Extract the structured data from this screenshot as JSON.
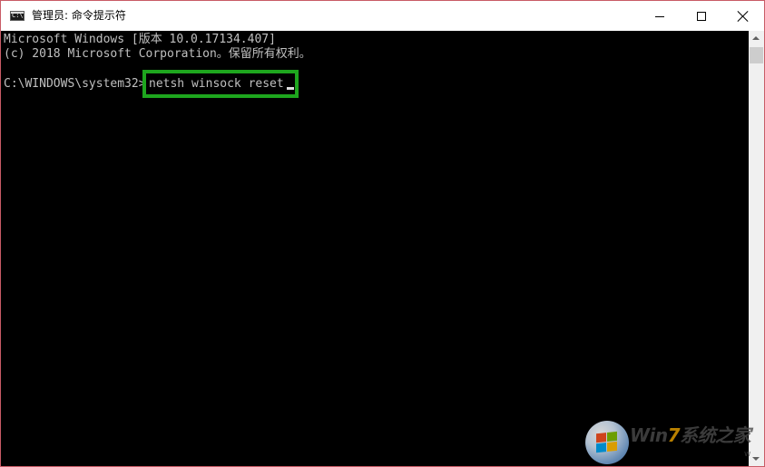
{
  "window": {
    "title": "管理员: 命令提示符",
    "icon": "cmd-icon"
  },
  "titlebar_buttons": {
    "minimize_icon": "minimize-icon",
    "maximize_icon": "maximize-icon",
    "close_icon": "close-icon"
  },
  "console": {
    "line1": "Microsoft Windows [版本 10.0.17134.407]",
    "line2": "(c) 2018 Microsoft Corporation。保留所有权利。",
    "prompt": "C:\\WINDOWS\\system32>",
    "command": "netsh winsock reset",
    "highlight_color": "#1ea61e",
    "background_color": "#000000",
    "text_color": "#c0c0c0"
  },
  "watermark": {
    "text_prefix": "Win",
    "text_accent": "7",
    "text_suffix": "系统之家",
    "url_fragment": "w"
  }
}
